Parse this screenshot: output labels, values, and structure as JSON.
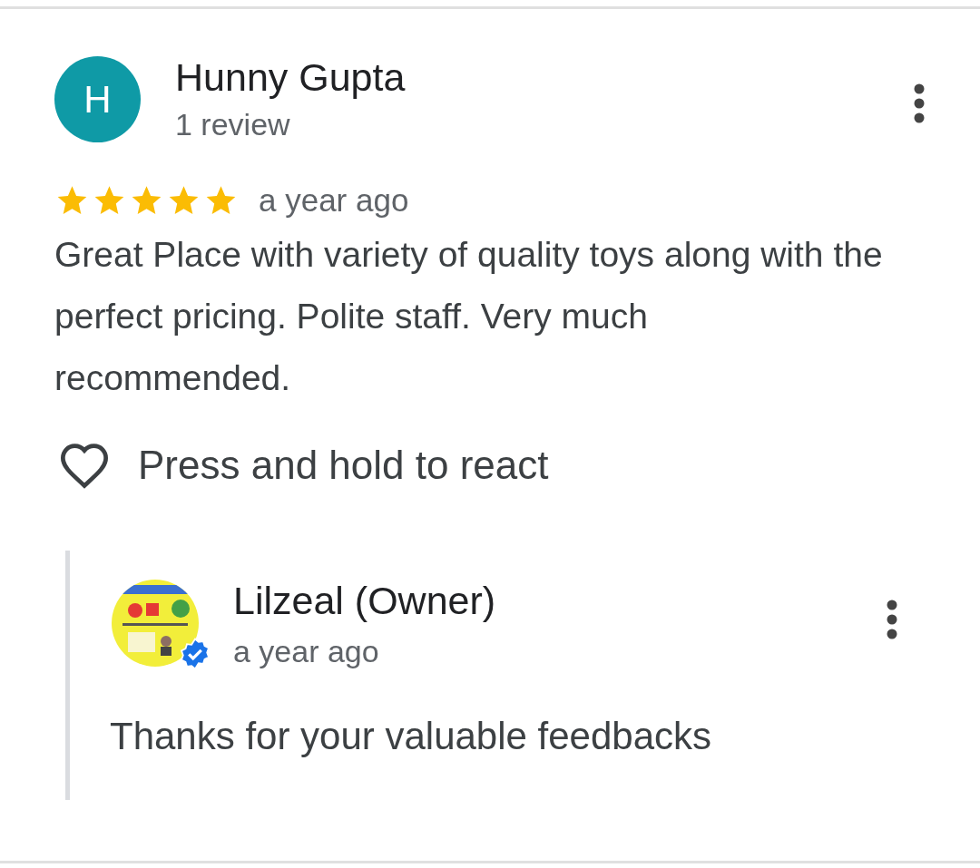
{
  "review": {
    "author": {
      "initial": "H",
      "name": "Hunny Gupta",
      "meta": "1 review"
    },
    "stars": 5,
    "time": "a year ago",
    "text": "Great Place with variety of quality toys along with the perfect pricing. Polite staff. Very much recommended.",
    "react_label": "Press and hold to react"
  },
  "owner_reply": {
    "avatar": {
      "kind": "picture",
      "verified": true
    },
    "name": "Lilzeal (Owner)",
    "time": "a year ago",
    "text": "Thanks for your valuable feedbacks"
  }
}
